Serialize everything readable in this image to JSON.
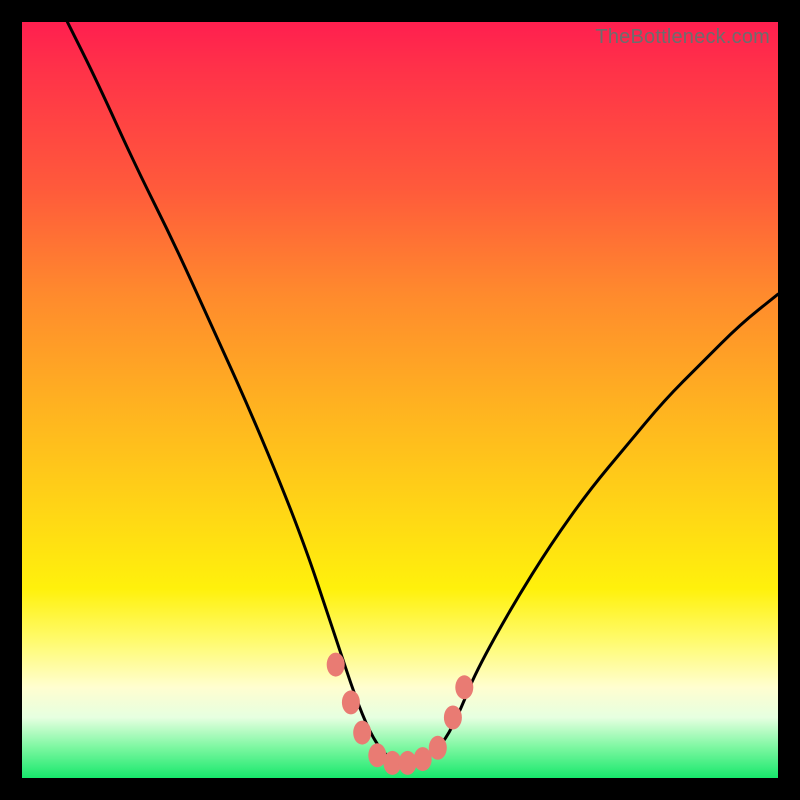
{
  "watermark": "TheBottleneck.com",
  "chart_data": {
    "type": "line",
    "title": "",
    "xlabel": "",
    "ylabel": "",
    "xlim": [
      0,
      100
    ],
    "ylim": [
      0,
      100
    ],
    "series": [
      {
        "name": "bottleneck-curve",
        "x": [
          6,
          10,
          15,
          20,
          25,
          30,
          35,
          38,
          40,
          42,
          44,
          46,
          48,
          50,
          52,
          54,
          56,
          58,
          60,
          65,
          70,
          75,
          80,
          85,
          90,
          95,
          100
        ],
        "values": [
          100,
          92,
          81,
          71,
          60,
          49,
          37,
          29,
          23,
          17,
          11,
          6,
          3,
          2,
          2,
          3,
          5,
          9,
          14,
          23,
          31,
          38,
          44,
          50,
          55,
          60,
          64
        ]
      }
    ],
    "markers": {
      "name": "highlight-dots",
      "points": [
        {
          "x": 41.5,
          "y": 15
        },
        {
          "x": 43.5,
          "y": 10
        },
        {
          "x": 45.0,
          "y": 6
        },
        {
          "x": 47.0,
          "y": 3
        },
        {
          "x": 49.0,
          "y": 2
        },
        {
          "x": 51.0,
          "y": 2
        },
        {
          "x": 53.0,
          "y": 2.5
        },
        {
          "x": 55.0,
          "y": 4
        },
        {
          "x": 57.0,
          "y": 8
        },
        {
          "x": 58.5,
          "y": 12
        }
      ],
      "color": "#e97b73"
    },
    "gradient_stops": [
      {
        "pos": 0,
        "color": "#ff1f4f"
      },
      {
        "pos": 50,
        "color": "#ffb021"
      },
      {
        "pos": 75,
        "color": "#fff10c"
      },
      {
        "pos": 100,
        "color": "#17e86c"
      }
    ]
  }
}
